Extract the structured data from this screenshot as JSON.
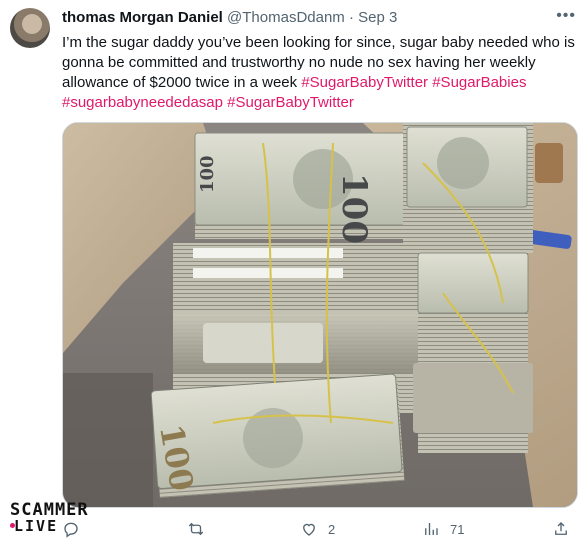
{
  "tweet": {
    "author_name": "thomas Morgan Daniel",
    "author_handle": "@ThomasDdanm",
    "separator": "·",
    "date": "Sep 3",
    "more_icon": "ellipsis-icon",
    "text_plain": "I’m the sugar daddy you’ve   been looking for since, sugar baby needed who is gonna be committed and trustworthy no nude no sex having her weekly allowance of $2000 twice in a week ",
    "hashtags": [
      "#SugarBabyTwitter",
      "#SugarBabies",
      "#sugarbabyneededasap",
      "#SugarBabyTwitter"
    ],
    "hashtag_color": "#e0196b"
  },
  "media": {
    "image_description_icon": "money-stacks-photo",
    "banknote_label": "100"
  },
  "actions": {
    "reply": {
      "icon": "reply-icon",
      "count": ""
    },
    "retweet": {
      "icon": "retweet-icon",
      "count": ""
    },
    "like": {
      "icon": "heart-icon",
      "count": "2"
    },
    "views": {
      "icon": "views-icon",
      "count": "71"
    },
    "share": {
      "icon": "share-icon",
      "count": ""
    }
  },
  "watermark": {
    "line1": "SCAMMER",
    "line2": "LIVE"
  }
}
